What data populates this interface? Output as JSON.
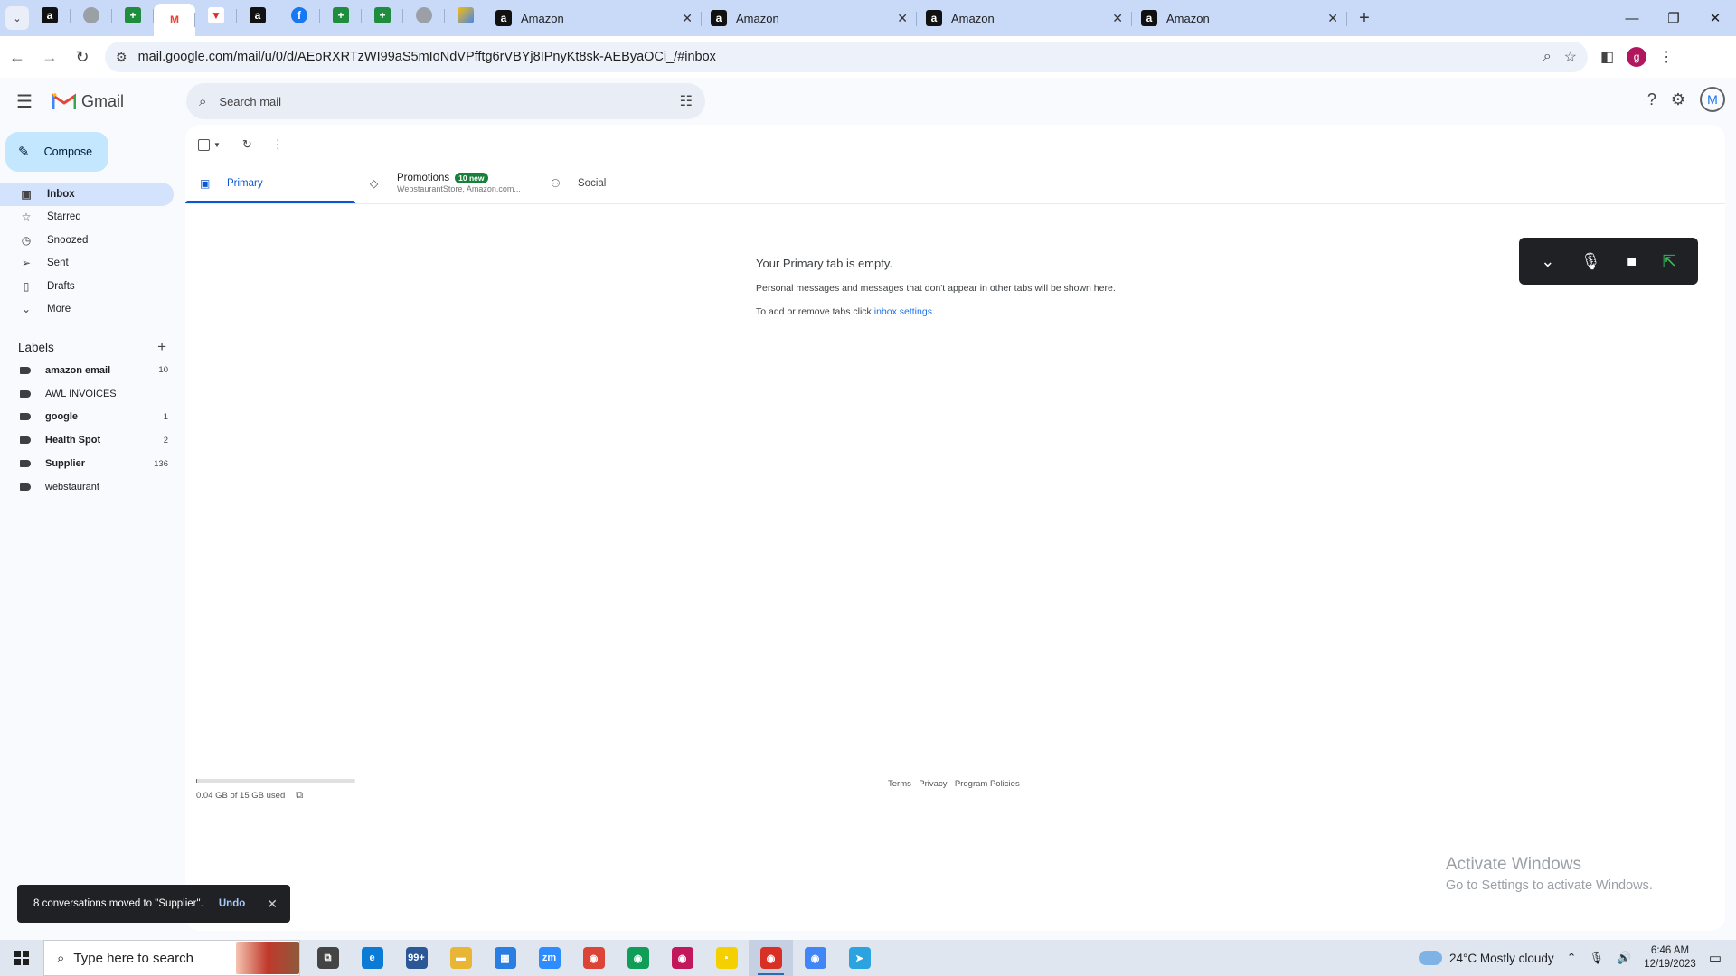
{
  "browser": {
    "pinned_tabs": [
      {
        "icon": "amazon-icon",
        "glyph": "a",
        "style": "amazon"
      },
      {
        "icon": "globe-icon",
        "glyph": "",
        "style": "globe"
      },
      {
        "icon": "sheets-icon",
        "glyph": "+",
        "style": "sheets"
      },
      {
        "icon": "gmail-icon",
        "glyph": "M",
        "style": "gmail",
        "active": true
      },
      {
        "icon": "red-app-icon",
        "glyph": "▼",
        "style": "red"
      },
      {
        "icon": "amazon-icon",
        "glyph": "a",
        "style": "amazon"
      },
      {
        "icon": "facebook-icon",
        "glyph": "f",
        "style": "fb"
      },
      {
        "icon": "sheets-icon",
        "glyph": "+",
        "style": "sheets"
      },
      {
        "icon": "sheets-icon",
        "glyph": "+",
        "style": "sheets"
      },
      {
        "icon": "globe-icon",
        "glyph": "",
        "style": "globe"
      },
      {
        "icon": "app-icon",
        "glyph": "",
        "style": "misc"
      }
    ],
    "tabs": [
      {
        "title": "Amazon"
      },
      {
        "title": "Amazon"
      },
      {
        "title": "Amazon"
      },
      {
        "title": "Amazon"
      }
    ],
    "url": "mail.google.com/mail/u/0/d/AEoRXRTzWI99aS5mIoNdVPfftg6rVBYj8IPnyKt8sk-AEByaOCi_/#inbox",
    "profile_initial": "g"
  },
  "gmail": {
    "product_name": "Gmail",
    "search_placeholder": "Search mail",
    "account_initial": "M",
    "compose_label": "Compose",
    "nav": [
      {
        "label": "Inbox",
        "icon": "inbox-icon",
        "glyph": "▣",
        "active": true
      },
      {
        "label": "Starred",
        "icon": "star-icon",
        "glyph": "☆"
      },
      {
        "label": "Snoozed",
        "icon": "clock-icon",
        "glyph": "◷"
      },
      {
        "label": "Sent",
        "icon": "send-icon",
        "glyph": "➢"
      },
      {
        "label": "Drafts",
        "icon": "draft-icon",
        "glyph": "▯"
      },
      {
        "label": "More",
        "icon": "chevron-down-icon",
        "glyph": "⌄"
      }
    ],
    "labels_heading": "Labels",
    "labels": [
      {
        "name": "amazon email",
        "count": "10",
        "bold": true
      },
      {
        "name": "AWL INVOICES",
        "count": "",
        "bold": false
      },
      {
        "name": "google",
        "count": "1",
        "bold": true
      },
      {
        "name": "Health Spot",
        "count": "2",
        "bold": true
      },
      {
        "name": "Supplier",
        "count": "136",
        "bold": true
      },
      {
        "name": "webstaurant",
        "count": "",
        "bold": false
      }
    ],
    "tabs": {
      "primary": "Primary",
      "promotions": "Promotions",
      "promotions_badge": "10 new",
      "promotions_senders": "WebstaurantStore, Amazon.com...",
      "social": "Social"
    },
    "empty": {
      "title": "Your Primary tab is empty.",
      "line1": "Personal messages and messages that don't appear in other tabs will be shown here.",
      "line2_prefix": "To add or remove tabs click ",
      "line2_link": "inbox settings",
      "line2_suffix": "."
    },
    "storage": {
      "text": "0.04 GB of 15 GB used",
      "fraction": 0.003
    },
    "footer": "Terms · Privacy · Program Policies",
    "snackbar": {
      "message": "8 conversations moved to \"Supplier\".",
      "undo": "Undo"
    },
    "watermark": {
      "line1": "Activate Windows",
      "line2": "Go to Settings to activate Windows."
    }
  },
  "taskbar": {
    "search_placeholder": "Type here to search",
    "apps": [
      {
        "icon": "task-view-icon",
        "glyph": "⧉",
        "color": "#444444"
      },
      {
        "icon": "edge-icon",
        "glyph": "e",
        "color": "#0c7bd6"
      },
      {
        "icon": "mail-app-icon",
        "glyph": "99+",
        "color": "#2b5797"
      },
      {
        "icon": "file-explorer-icon",
        "glyph": "▬",
        "color": "#e8b634"
      },
      {
        "icon": "store-icon",
        "glyph": "▦",
        "color": "#2a7de1"
      },
      {
        "icon": "zoom-icon",
        "glyph": "zm",
        "color": "#2d8cff"
      },
      {
        "icon": "chrome-icon",
        "glyph": "◉",
        "color": "#db4437"
      },
      {
        "icon": "chrome-icon",
        "glyph": "◉",
        "color": "#0f9d58"
      },
      {
        "icon": "chrome-icon",
        "glyph": "◉",
        "color": "#c2185b"
      },
      {
        "icon": "sticky-notes-icon",
        "glyph": "▪",
        "color": "#f4d000"
      },
      {
        "icon": "chrome-icon",
        "glyph": "◉",
        "color": "#d93025",
        "active": true
      },
      {
        "icon": "chrome-icon",
        "glyph": "◉",
        "color": "#4285f4"
      },
      {
        "icon": "telegram-icon",
        "glyph": "➤",
        "color": "#2aa3df"
      }
    ],
    "weather": "24°C  Mostly cloudy",
    "time": "6:46 AM",
    "date": "12/19/2023"
  }
}
